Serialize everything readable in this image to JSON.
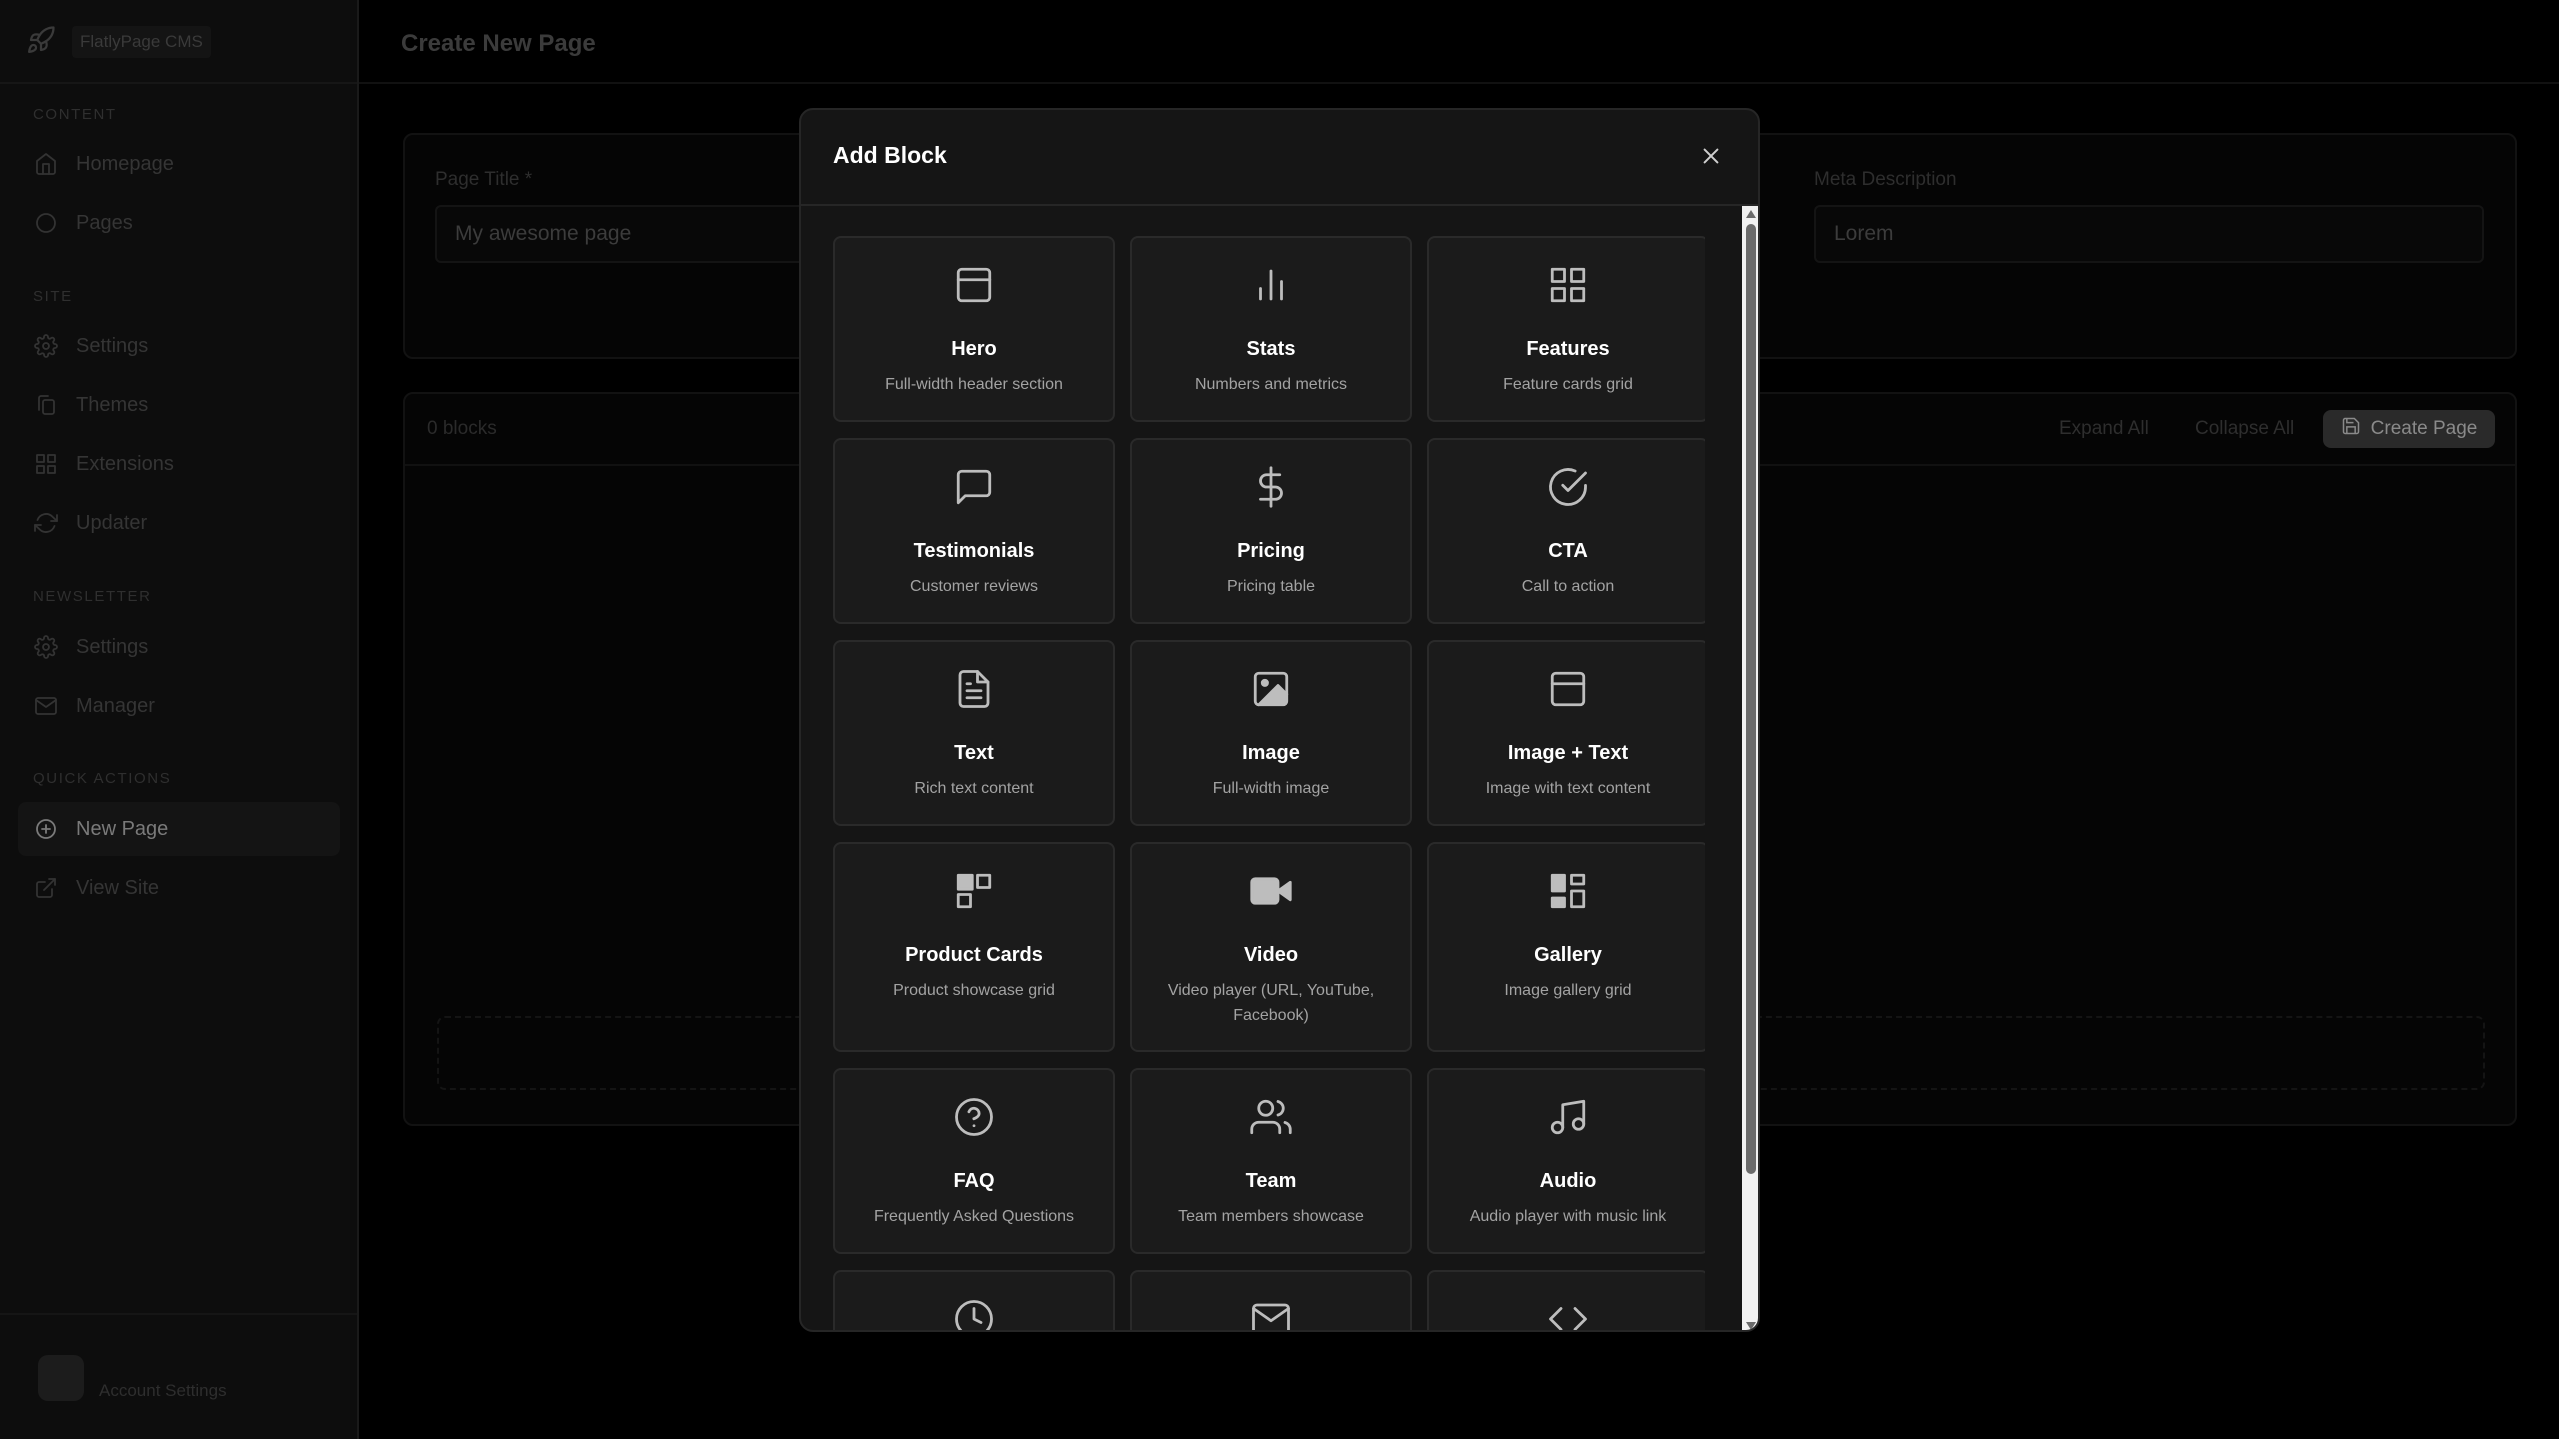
{
  "app": {
    "name": "FlatlyPage CMS"
  },
  "sidebar": {
    "sections": [
      {
        "title": "CONTENT",
        "items": [
          {
            "label": "Homepage",
            "icon": "home-icon"
          },
          {
            "label": "Pages",
            "icon": "circle-icon"
          }
        ]
      },
      {
        "title": "SITE",
        "items": [
          {
            "label": "Settings",
            "icon": "gear-icon"
          },
          {
            "label": "Themes",
            "icon": "copy-icon"
          },
          {
            "label": "Extensions",
            "icon": "grid-icon"
          },
          {
            "label": "Updater",
            "icon": "refresh-icon"
          }
        ]
      },
      {
        "title": "NEWSLETTER",
        "items": [
          {
            "label": "Settings",
            "icon": "gear-icon"
          },
          {
            "label": "Manager",
            "icon": "mail-icon"
          }
        ]
      },
      {
        "title": "QUICK ACTIONS",
        "items": [
          {
            "label": "New Page",
            "icon": "plus-circle-icon",
            "active": true
          },
          {
            "label": "View Site",
            "icon": "external-link-icon"
          }
        ]
      }
    ],
    "account_label": "Account Settings"
  },
  "header": {
    "title": "Create New Page"
  },
  "form": {
    "page_title_label": "Page Title *",
    "page_title_value": "My awesome page",
    "meta_description_label": "Meta Description",
    "meta_description_value": "Lorem"
  },
  "blocks_panel": {
    "count_label": "0 blocks",
    "expand_all": "Expand All",
    "collapse_all": "Collapse All",
    "create_page": "Create Page"
  },
  "modal": {
    "title": "Add Block",
    "blocks": [
      {
        "title": "Hero",
        "desc": "Full-width header section",
        "icon": "layout-icon"
      },
      {
        "title": "Stats",
        "desc": "Numbers and metrics",
        "icon": "bar-chart-icon"
      },
      {
        "title": "Features",
        "desc": "Feature cards grid",
        "icon": "grid-icon"
      },
      {
        "title": "Testimonials",
        "desc": "Customer reviews",
        "icon": "message-square-icon"
      },
      {
        "title": "Pricing",
        "desc": "Pricing table",
        "icon": "dollar-icon"
      },
      {
        "title": "CTA",
        "desc": "Call to action",
        "icon": "check-circle-icon"
      },
      {
        "title": "Text",
        "desc": "Rich text content",
        "icon": "file-text-icon"
      },
      {
        "title": "Image",
        "desc": "Full-width image",
        "icon": "image-icon"
      },
      {
        "title": "Image + Text",
        "desc": "Image with text content",
        "icon": "layout-icon"
      },
      {
        "title": "Product Cards",
        "desc": "Product showcase grid",
        "icon": "product-grid-icon"
      },
      {
        "title": "Video",
        "desc": "Video player (URL, YouTube, Facebook)",
        "icon": "video-icon"
      },
      {
        "title": "Gallery",
        "desc": "Image gallery grid",
        "icon": "dashboard-icon"
      },
      {
        "title": "FAQ",
        "desc": "Frequently Asked Questions",
        "icon": "help-circle-icon"
      },
      {
        "title": "Team",
        "desc": "Team members showcase",
        "icon": "users-icon"
      },
      {
        "title": "Audio",
        "desc": "Audio player with music link",
        "icon": "music-icon"
      },
      {
        "title": "",
        "desc": "",
        "icon": "clock-icon"
      },
      {
        "title": "",
        "desc": "",
        "icon": "mail-icon"
      },
      {
        "title": "",
        "desc": "",
        "icon": "code-icon"
      }
    ]
  }
}
